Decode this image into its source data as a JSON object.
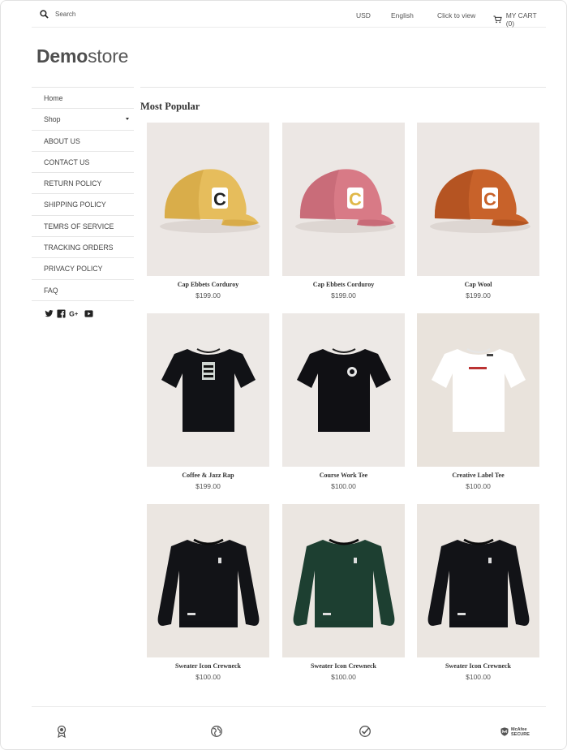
{
  "header": {
    "search_placeholder": "Search",
    "currency": "USD",
    "language": "English",
    "click_to_view": "Click to view",
    "cart_label": "MY CART (0)"
  },
  "logo": {
    "bold": "Demo",
    "light": "store"
  },
  "sidebar": {
    "items": [
      {
        "label": "Home"
      },
      {
        "label": "Shop",
        "has_dropdown": true
      },
      {
        "label": "ABOUT US"
      },
      {
        "label": "CONTACT US"
      },
      {
        "label": "RETURN POLICY"
      },
      {
        "label": "SHIPPING POLICY"
      },
      {
        "label": "TEMRS OF SERVICE"
      },
      {
        "label": "TRACKING ORDERS"
      },
      {
        "label": "PRIVACY POLICY"
      },
      {
        "label": "FAQ"
      }
    ],
    "social_icons": [
      "twitter-icon",
      "facebook-icon",
      "google-plus-icon",
      "youtube-icon"
    ]
  },
  "main": {
    "section_title": "Most Popular",
    "products": [
      {
        "name": "Cap Ebbets Corduroy",
        "price": "$199.00",
        "image": "yellow-cap"
      },
      {
        "name": "Cap Ebbets Corduroy",
        "price": "$199.00",
        "image": "pink-cap"
      },
      {
        "name": "Cap Wool",
        "price": "$199.00",
        "image": "orange-cap"
      },
      {
        "name": "Coffee & Jazz Rap",
        "price": "$199.00",
        "image": "black-tee-graphic"
      },
      {
        "name": "Course Work Tee",
        "price": "$100.00",
        "image": "black-tee-logo"
      },
      {
        "name": "Creative Label Tee",
        "price": "$100.00",
        "image": "white-tee"
      },
      {
        "name": "Sweater Icon Crewneck",
        "price": "$100.00",
        "image": "black-crewneck"
      },
      {
        "name": "Sweater Icon Crewneck",
        "price": "$100.00",
        "image": "green-crewneck"
      },
      {
        "name": "Sweater Icon Crewneck",
        "price": "$100.00",
        "image": "black-crewneck"
      }
    ]
  },
  "footer": {
    "badges": [
      "award-icon",
      "globe-icon",
      "check-circle-icon",
      "mcafee-secure-icon"
    ],
    "mcafee_line1": "McAfee",
    "mcafee_line2": "SECURE"
  },
  "colors": {
    "text": "#333333",
    "border": "#e6e6e6",
    "image_background": "#ede9e6"
  }
}
